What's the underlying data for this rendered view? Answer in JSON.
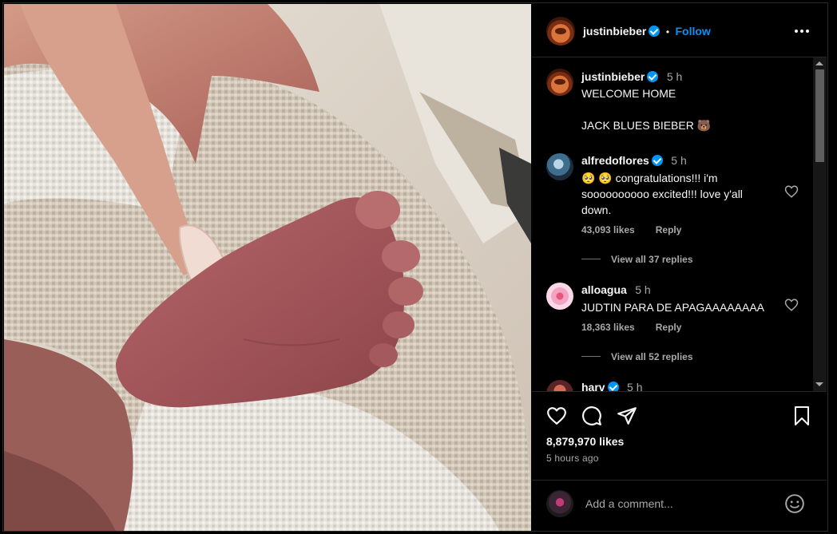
{
  "header": {
    "username": "justinbieber",
    "separator": "•",
    "follow_label": "Follow",
    "more_icon": "more-horizontal-icon"
  },
  "caption": {
    "username": "justinbieber",
    "time": "5 h",
    "line1": "WELCOME HOME",
    "line2": "JACK BLUES BIEBER 🐻"
  },
  "comments": [
    {
      "username": "alfredoflores",
      "time": "5 h",
      "text_line1": "🥺 🥺 congratulations!!! i'm",
      "text_line2": "soooooooooo excited!!! love y'all",
      "text_line3": "down.",
      "likes": "43,093 likes",
      "reply_label": "Reply",
      "view_replies": "View all 37 replies"
    },
    {
      "username": "alloagua",
      "time": "5 h",
      "text_line1": "JUDTIN PARA DE APAGAAAAAAAA",
      "likes": "18,363 likes",
      "reply_label": "Reply",
      "view_replies": "View all 52 replies"
    },
    {
      "username": "harv",
      "time": "5 h"
    }
  ],
  "actions": {
    "like_icon": "heart-icon",
    "comment_icon": "comment-icon",
    "share_icon": "share-icon",
    "save_icon": "bookmark-icon"
  },
  "likes_count": "8,879,970 likes",
  "posted": "5 hours ago",
  "comment_box": {
    "placeholder": "Add a comment...",
    "emoji_icon": "emoji-icon"
  },
  "colors": {
    "background": "#000000",
    "accent": "#0095f6",
    "muted": "#a8a8a8"
  }
}
